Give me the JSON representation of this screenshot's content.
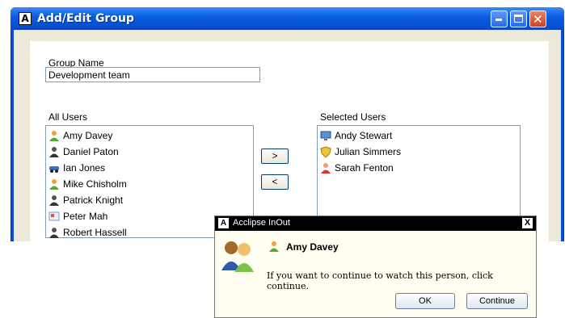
{
  "window": {
    "title": "Add/Edit Group",
    "icon": "A"
  },
  "form": {
    "group_name_label": "Group Name",
    "group_name_value": "Development team",
    "all_users_label": "All Users",
    "selected_users_label": "Selected Users",
    "add_button": ">",
    "remove_button": "<"
  },
  "all_users": [
    {
      "name": "Amy Davey",
      "icon": "user-orange-icon"
    },
    {
      "name": "Daniel Paton",
      "icon": "user-dark-icon"
    },
    {
      "name": "Ian Jones",
      "icon": "car-icon"
    },
    {
      "name": "Mike Chisholm",
      "icon": "user-orange-icon"
    },
    {
      "name": "Patrick Knight",
      "icon": "user-dark-icon"
    },
    {
      "name": "Peter Mah",
      "icon": "card-icon"
    },
    {
      "name": "Robert Hassell",
      "icon": "user-dark-icon"
    }
  ],
  "selected_users": [
    {
      "name": "Andy Stewart",
      "icon": "monitor-icon"
    },
    {
      "name": "Julian Simmers",
      "icon": "shield-icon"
    },
    {
      "name": "Sarah Fenton",
      "icon": "user-red-icon"
    }
  ],
  "dialog": {
    "title": "Acclipse InOut",
    "title_icon": "A",
    "close": "X",
    "person": "Amy Davey",
    "message": "If you want to continue to watch this person, click continue.",
    "ok": "OK",
    "continue": "Continue"
  }
}
